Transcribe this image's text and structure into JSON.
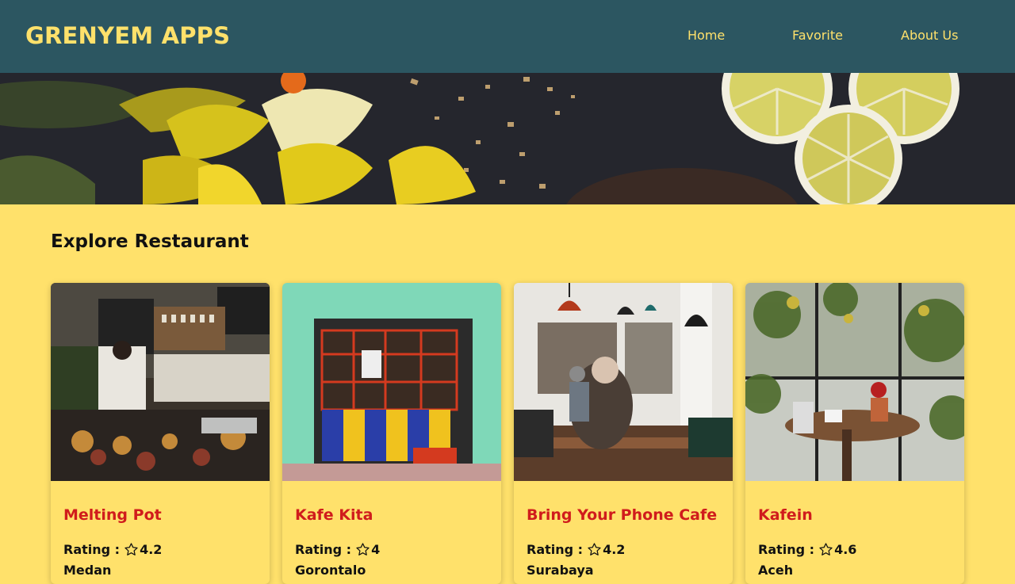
{
  "header": {
    "brand": "GRENYEM APPS",
    "nav": [
      {
        "label": "Home"
      },
      {
        "label": "Favorite"
      },
      {
        "label": "About Us"
      }
    ]
  },
  "colors": {
    "navbar_bg": "#2c5661",
    "accent_yellow": "#ffe16b",
    "restaurant_name_red": "#d01c1c"
  },
  "main": {
    "title": "Explore Restaurant",
    "rating_label": "Rating :",
    "restaurants": [
      {
        "name": "Melting Pot",
        "rating": "4.2",
        "city": "Medan"
      },
      {
        "name": "Kafe Kita",
        "rating": "4",
        "city": "Gorontalo"
      },
      {
        "name": "Bring Your Phone Cafe",
        "rating": "4.2",
        "city": "Surabaya"
      },
      {
        "name": "Kafein",
        "rating": "4.6",
        "city": "Aceh"
      }
    ]
  },
  "icons": {
    "rating": "star-outline-icon"
  }
}
